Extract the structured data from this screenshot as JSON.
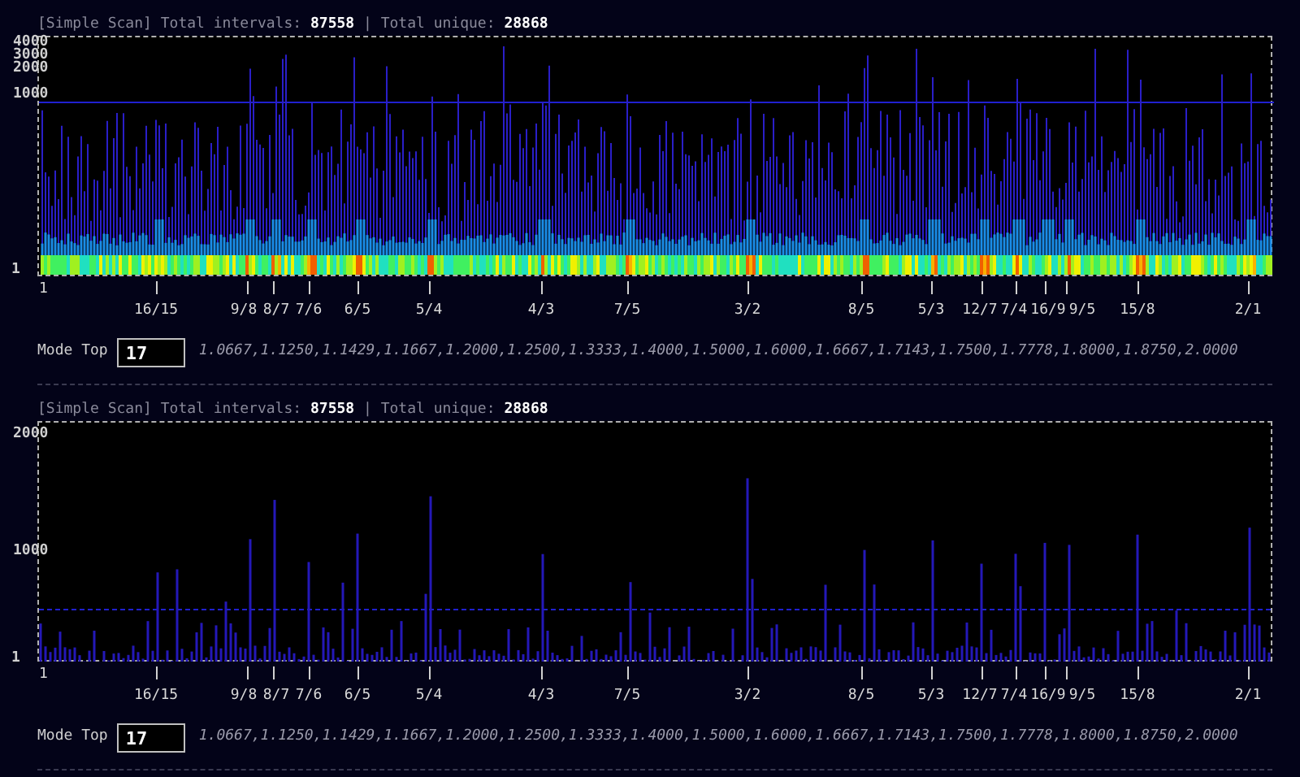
{
  "panels": [
    {
      "kind": "heatmap",
      "header": "[Simple Scan] Total intervals: **87558** | Total unique: **28868**",
      "y_labels": [
        "4000",
        "3000",
        "2000",
        "1000",
        "1"
      ],
      "x_labels": [
        "1",
        "16/15",
        "9/8",
        "8/7",
        "7/6",
        "6/5",
        "5/4",
        "4/3",
        "7/5",
        "3/2",
        "8/5",
        "5/3",
        "12/7",
        "7/4",
        "16/9",
        "9/5",
        "15/8",
        "2/1"
      ],
      "mode_top": {
        "label": "Mode Top",
        "value": "17",
        "modes": "1.0667,1.1250,1.1429,1.1667,1.2000,1.2500,1.3333,1.4000,1.5000,1.6000,1.6667,1.7143,1.7500,1.7778,1.8000,1.8750,2.0000"
      }
    },
    {
      "kind": "bars",
      "header": "[Simple Scan] Total intervals: **87558** | Total unique: **28868**",
      "y_labels": [
        "2000",
        "1000",
        "1"
      ],
      "x_labels": [
        "1",
        "16/15",
        "9/8",
        "8/7",
        "7/6",
        "6/5",
        "5/4",
        "4/3",
        "7/5",
        "3/2",
        "8/5",
        "5/3",
        "12/7",
        "7/4",
        "16/9",
        "9/5",
        "15/8",
        "2/1"
      ],
      "mode_top": {
        "label": "Mode Top",
        "value": "17",
        "modes": "1.0667,1.1250,1.1429,1.1667,1.2000,1.2500,1.3333,1.4000,1.5000,1.6000,1.6667,1.7143,1.7500,1.7778,1.8000,1.8750,2.0000"
      }
    }
  ]
}
